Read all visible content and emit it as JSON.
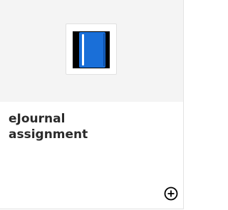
{
  "card": {
    "title_line1": "eJournal",
    "title_line2": "assignment",
    "icon": "ejournal-book-icon",
    "action_icon": "add-circle-icon"
  },
  "colors": {
    "header_bg": "#f4f4f4",
    "book_blue": "#1a6fd8",
    "title_text": "#2a2a2a"
  }
}
